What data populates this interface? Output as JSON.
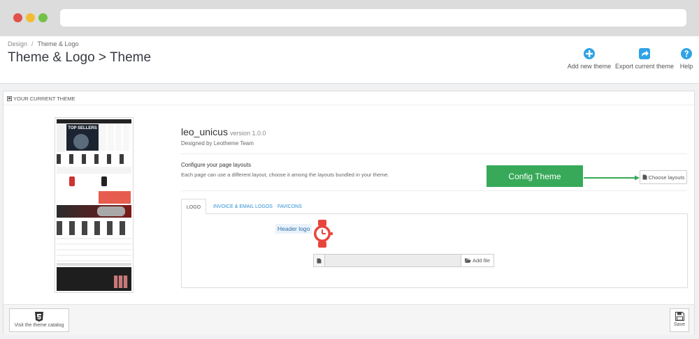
{
  "breadcrumb": {
    "parent": "Design",
    "separator": "/",
    "current": "Theme & Logo"
  },
  "page_title": "Theme & Logo > Theme",
  "toolbar": {
    "add_new_theme": "Add new theme",
    "export_current_theme": "Export current theme",
    "help": "Help"
  },
  "panel": {
    "heading": "YOUR CURRENT THEME"
  },
  "theme": {
    "name": "leo_unicus",
    "version": "version 1.0.0",
    "designed_by": "Designed by Leotheme Team"
  },
  "layouts": {
    "title": "Configure your page layouts",
    "description": "Each page can use a different layout, choose it among the layouts bundled in your theme.",
    "choose_button": "Choose layouts"
  },
  "config_theme_button": "Config Theme",
  "tabs": [
    {
      "label": "LOGO",
      "active": true
    },
    {
      "label": "INVOICE & EMAIL LOGOS",
      "active": false
    },
    {
      "label": "FAVICONS",
      "active": false
    }
  ],
  "logo_tab": {
    "header_logo_label": "Header logo",
    "add_file_button": "Add file"
  },
  "footer": {
    "catalog_button": "Visit the theme catalog",
    "save_button": "Save"
  },
  "preview": {
    "banner_text": "TOP SELLERS"
  },
  "colors": {
    "accent_blue": "#2fa3e6",
    "config_green": "#37a959",
    "logo_red": "#e8453c"
  },
  "icons": {
    "add": "plus-circle-icon",
    "export": "share-icon",
    "help": "question-circle-icon",
    "heading": "shield-icon",
    "choose": "file-icon",
    "add_file": "folder-open-icon",
    "catalog": "html5-icon",
    "save": "floppy-disk-icon"
  }
}
